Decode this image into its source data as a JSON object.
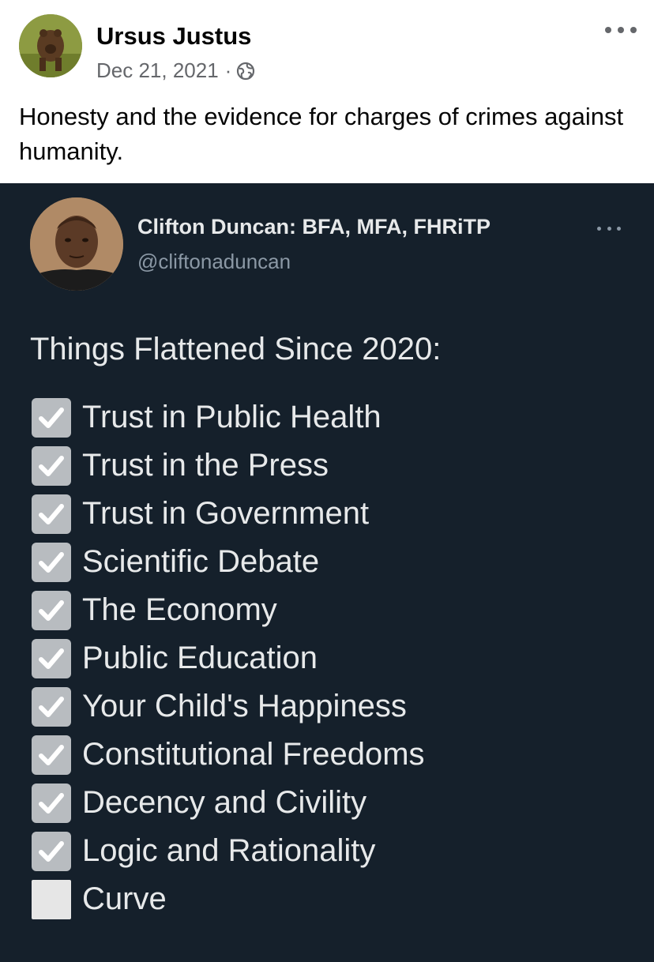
{
  "post": {
    "author": "Ursus Justus",
    "date": "Dec 21, 2021",
    "separator": "·",
    "privacy_icon": "globe-icon",
    "caption": "Honesty and the evidence for charges of crimes against humanity."
  },
  "tweet": {
    "display_name": "Clifton Duncan: BFA, MFA, FHRiTP",
    "handle": "@cliftonaduncan",
    "heading": "Things Flattened Since 2020:",
    "items": [
      {
        "label": "Trust in Public Health",
        "checked": true
      },
      {
        "label": "Trust in the Press",
        "checked": true
      },
      {
        "label": "Trust in Government",
        "checked": true
      },
      {
        "label": "Scientific Debate",
        "checked": true
      },
      {
        "label": "The Economy",
        "checked": true
      },
      {
        "label": "Public Education",
        "checked": true
      },
      {
        "label": "Your Child's Happiness",
        "checked": true
      },
      {
        "label": "Constitutional Freedoms",
        "checked": true
      },
      {
        "label": "Decency and Civility",
        "checked": true
      },
      {
        "label": "Logic and Rationality",
        "checked": true
      },
      {
        "label": "Curve",
        "checked": false
      }
    ]
  },
  "colors": {
    "tweet_background": "#15202b",
    "tweet_text": "#e7e9ea",
    "checkbox_checked": "#b8bcc0",
    "checkbox_unchecked": "#e6e6e6"
  }
}
